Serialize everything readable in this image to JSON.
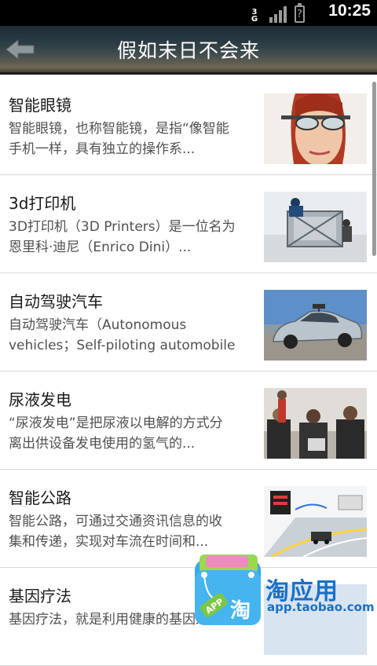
{
  "status_bar": {
    "network": "3G",
    "time": "10:25"
  },
  "header": {
    "title": "假如末日不会来"
  },
  "articles": [
    {
      "title": "智能眼镜",
      "desc_line1": "智能眼镜，也称智能镜，是指“像智能",
      "desc_line2": "手机一样，具有独立的操作系..."
    },
    {
      "title": "3d打印机",
      "desc_line1": "3D打印机（3D Printers）是一位名为",
      "desc_line2": "恩里科·迪尼（Enrico Dini）..."
    },
    {
      "title": "自动驾驶汽车",
      "desc_line1": "自动驾驶汽车（Autonomous",
      "desc_line2": "vehicles；Self-piloting automobile"
    },
    {
      "title": "尿液发电",
      "desc_line1": "“尿液发电”是把尿液以电解的方式分",
      "desc_line2": "离出供设备发电使用的氢气的..."
    },
    {
      "title": "智能公路",
      "desc_line1": "智能公路，可通过交通资讯信息的收",
      "desc_line2": "集和传递，实现对车流在时间和..."
    },
    {
      "title": "基因疗法",
      "desc_line1": "基因疗法，就是利用健康的基因来",
      "desc_line2": ""
    }
  ],
  "watermark": {
    "name": "淘应用",
    "url": "app.taobao.com",
    "badge": "APP",
    "glyph": "淘"
  },
  "icons": {
    "back": "back-arrow-icon"
  }
}
